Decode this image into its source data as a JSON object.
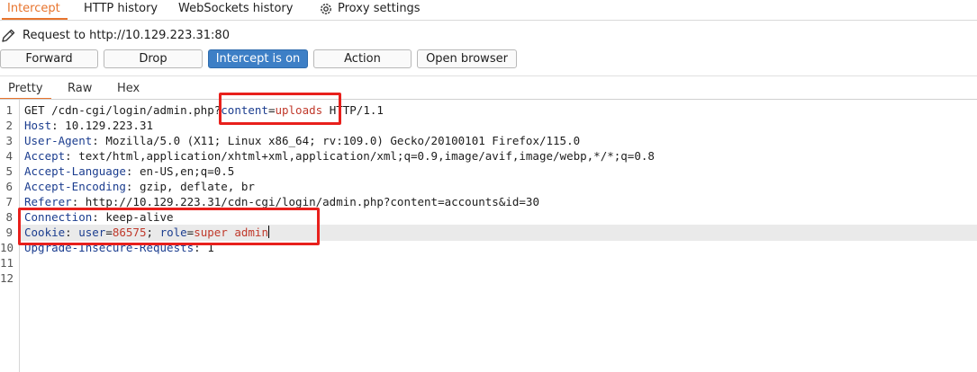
{
  "top_tabs": [
    {
      "label": "Intercept",
      "active": true
    },
    {
      "label": "HTTP history",
      "active": false
    },
    {
      "label": "WebSockets history",
      "active": false
    },
    {
      "label": "Proxy settings",
      "active": false,
      "icon": "gear-icon"
    }
  ],
  "request_line": {
    "icon": "pencil-icon",
    "text": "Request to http://10.129.223.31:80"
  },
  "buttons": {
    "forward": "Forward",
    "drop": "Drop",
    "intercept": "Intercept is on",
    "action": "Action",
    "open_browser": "Open browser"
  },
  "editor_tabs": [
    {
      "label": "Pretty",
      "active": true
    },
    {
      "label": "Raw",
      "active": false
    },
    {
      "label": "Hex",
      "active": false
    }
  ],
  "line_numbers": [
    "1",
    "2",
    "3",
    "4",
    "5",
    "6",
    "7",
    "8",
    "9",
    "10",
    "11",
    "12"
  ],
  "request": {
    "line1": {
      "method": "GET ",
      "path": "/cdn-cgi/login/admin.php",
      "q": "?",
      "param_name": "content",
      "eq": "=",
      "param_value": "uploads",
      "proto": " HTTP/1.1"
    },
    "line2": {
      "name": "Host",
      "sep": ": ",
      "value": "10.129.223.31"
    },
    "line3": {
      "name": "User-Agent",
      "sep": ": ",
      "value": "Mozilla/5.0 (X11; Linux x86_64; rv:109.0) Gecko/20100101 Firefox/115.0"
    },
    "line4": {
      "name": "Accept",
      "sep": ": ",
      "value": "text/html,application/xhtml+xml,application/xml;q=0.9,image/avif,image/webp,*/*;q=0.8"
    },
    "line5": {
      "name": "Accept-Language",
      "sep": ": ",
      "value": "en-US,en;q=0.5"
    },
    "line6": {
      "name": "Accept-Encoding",
      "sep": ": ",
      "value": "gzip, deflate, br"
    },
    "line7": {
      "name": "Referer",
      "sep": ": ",
      "value": "http://10.129.223.31/cdn-cgi/login/admin.php?content=accounts&id=30"
    },
    "line8": {
      "name": "Connection",
      "sep": ": ",
      "value": "keep-alive"
    },
    "line9": {
      "name": "Cookie",
      "sep": ": ",
      "c1_name": "user",
      "c1_eq": "=",
      "c1_value": "86575",
      "c_sep": "; ",
      "c2_name": "role",
      "c2_eq": "=",
      "c2_value": "super admin"
    },
    "line10": {
      "name": "Upgrade-Insecure-Requests",
      "sep": ": ",
      "value": "1"
    }
  },
  "colors": {
    "accent": "#e8742d",
    "intercept_on": "#3d7fc6",
    "header_name": "#1b3d8f",
    "param_value": "#c0392b",
    "annotation": "#e8201c"
  }
}
